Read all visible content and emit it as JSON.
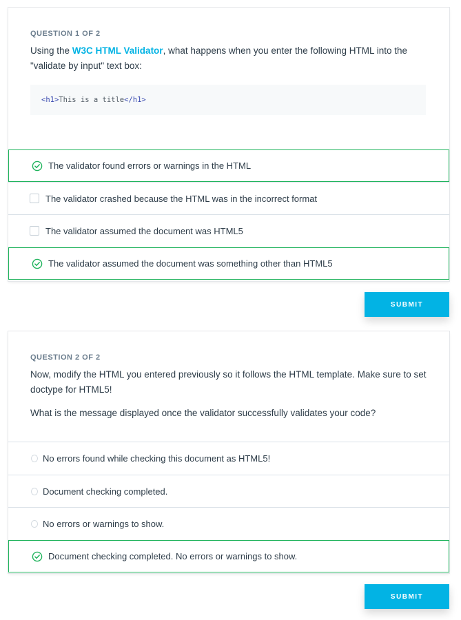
{
  "q1": {
    "number_label": "QUESTION 1 OF 2",
    "prompt_before": "Using the ",
    "link_text": "W3C HTML Validator",
    "prompt_after": ", what happens when you enter the following HTML into the \"validate by input\" text box:",
    "code": {
      "open_tag": "<h1>",
      "text": "This is a title",
      "close_tag": "</h1>"
    },
    "options": [
      {
        "label": "The validator found errors or warnings in the HTML",
        "checked": true
      },
      {
        "label": "The validator crashed because the HTML was in the incorrect format",
        "checked": false
      },
      {
        "label": "The validator assumed the document was HTML5",
        "checked": false
      },
      {
        "label": "The validator assumed the document was something other than HTML5",
        "checked": true
      }
    ],
    "submit_label": "SUBMIT"
  },
  "q2": {
    "number_label": "QUESTION 2 OF 2",
    "prompt1": "Now, modify the HTML you entered previously so it follows the HTML template. Make sure to set doctype for HTML5!",
    "prompt2": "What is the message displayed once the validator successfully validates your code?",
    "options": [
      {
        "label": "No errors found while checking this document as HTML5!",
        "selected": false
      },
      {
        "label": "Document checking completed.",
        "selected": false
      },
      {
        "label": "No errors or warnings to show.",
        "selected": false
      },
      {
        "label": "Document checking completed. No errors or warnings to show.",
        "selected": true
      }
    ],
    "submit_label": "SUBMIT"
  },
  "colors": {
    "accent": "#02b3e4",
    "correct": "#1fb35c",
    "text": "#2e3d49",
    "muted": "#6c7e8e"
  }
}
